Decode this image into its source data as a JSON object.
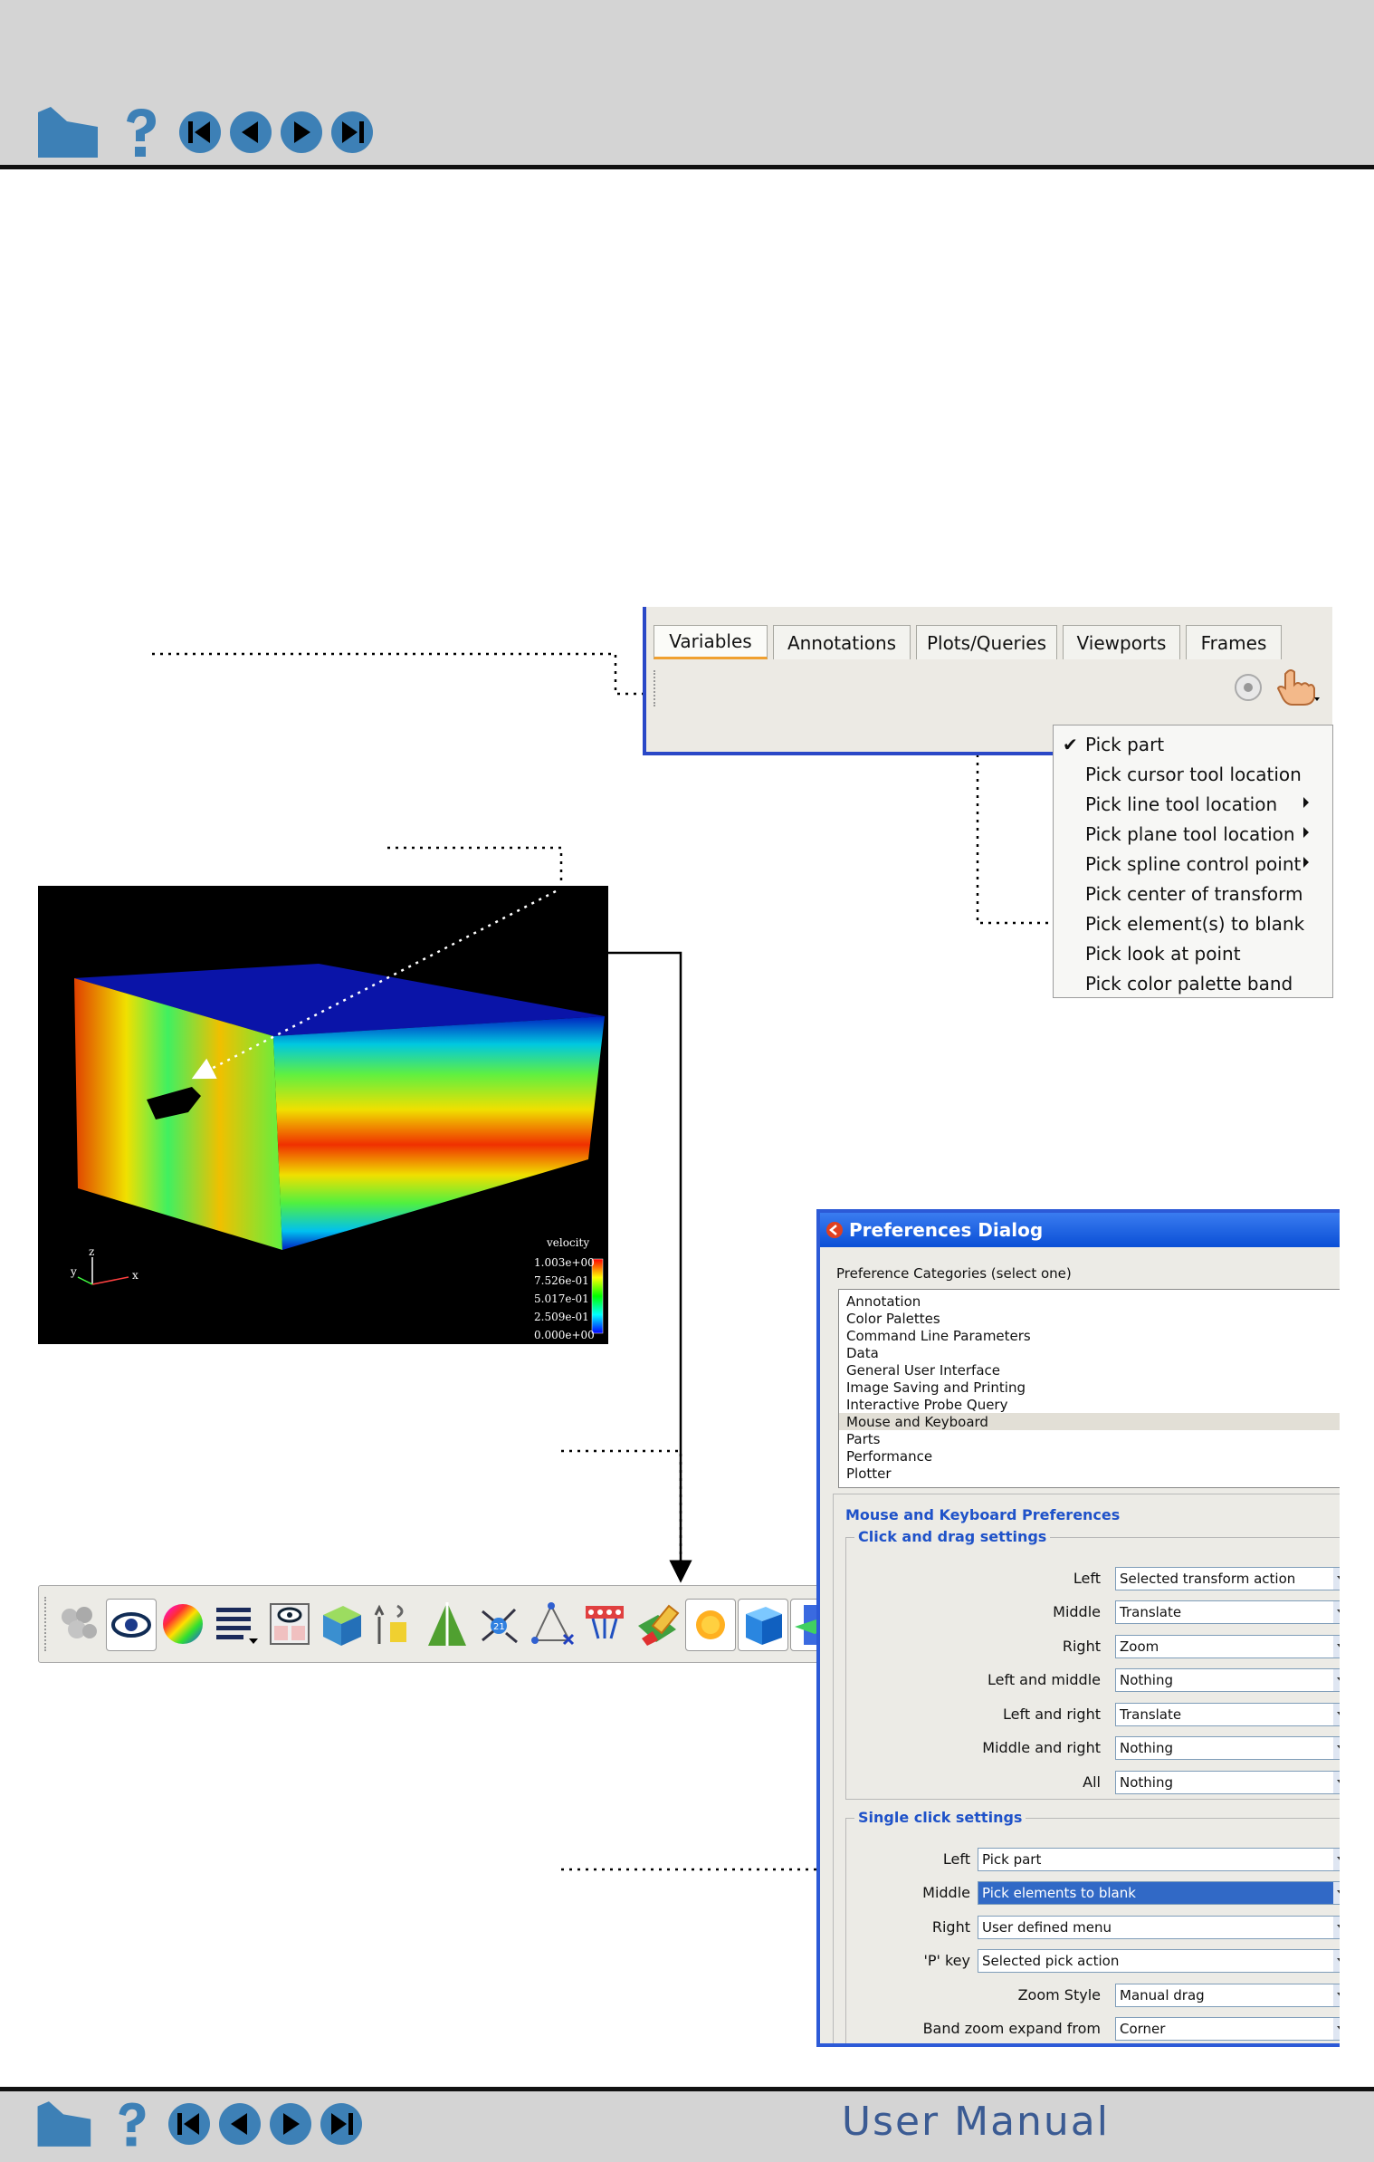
{
  "footer": {
    "title": "User Manual"
  },
  "nav": {
    "buttons": [
      "home-icon",
      "help-icon",
      "first-page-icon",
      "previous-page-icon",
      "next-page-icon",
      "last-page-icon"
    ]
  },
  "tabs": [
    "Variables",
    "Annotations",
    "Plots/Queries",
    "Viewports",
    "Frames"
  ],
  "pick_menu": {
    "items": [
      {
        "label": "Pick part",
        "checked": true,
        "submenu": false
      },
      {
        "label": "Pick cursor tool location",
        "checked": false,
        "submenu": false
      },
      {
        "label": "Pick line tool location",
        "checked": false,
        "submenu": true
      },
      {
        "label": "Pick plane tool location",
        "checked": false,
        "submenu": true
      },
      {
        "label": "Pick spline control point",
        "checked": false,
        "submenu": true
      },
      {
        "label": "Pick center of transform",
        "checked": false,
        "submenu": false
      },
      {
        "label": "Pick element(s) to blank",
        "checked": false,
        "submenu": false
      },
      {
        "label": "Pick look at point",
        "checked": false,
        "submenu": false
      },
      {
        "label": "Pick color palette band",
        "checked": false,
        "submenu": false
      }
    ]
  },
  "viewport": {
    "legend_title": "velocity",
    "legend_values": [
      "1.003e+00",
      "7.526e-01",
      "5.017e-01",
      "2.509e-01",
      "0.000e+00"
    ],
    "axis_labels": {
      "x": "x",
      "y": "y",
      "z": "z"
    }
  },
  "toolbar": {
    "tools": [
      "parts-icon",
      "visibility-eye-icon",
      "color-palette-icon",
      "line-style-icon",
      "view-mode-icon",
      "grid-cube-icon",
      "element-tool-icon",
      "clip-tool-icon",
      "coordinate-tool-icon",
      "node-tool-icon",
      "particle-tool-icon",
      "blank-eraser-icon",
      "light-sun-icon",
      "shaded-cube-icon",
      "plane-tool-icon",
      "lightning-icon"
    ]
  },
  "prefs": {
    "title": "Preferences Dialog",
    "categories_label": "Preference Categories (select one)",
    "categories": [
      "Annotation",
      "Color Palettes",
      "Command Line Parameters",
      "Data",
      "General User Interface",
      "Image Saving and Printing",
      "Interactive Probe Query",
      "Mouse and Keyboard",
      "Parts",
      "Performance",
      "Plotter"
    ],
    "selected_category": "Mouse and Keyboard",
    "section_title": "Mouse and Keyboard Preferences",
    "drag_group": "Click and drag settings",
    "drag_rows": [
      {
        "label": "Left",
        "value": "Selected transform action"
      },
      {
        "label": "Middle",
        "value": "Translate"
      },
      {
        "label": "Right",
        "value": "Zoom"
      },
      {
        "label": "Left and middle",
        "value": "Nothing"
      },
      {
        "label": "Left and right",
        "value": "Translate"
      },
      {
        "label": "Middle and right",
        "value": "Nothing"
      },
      {
        "label": "All",
        "value": "Nothing"
      }
    ],
    "single_group": "Single click settings",
    "single_rows": [
      {
        "label": "Left",
        "value": "Pick part",
        "selected": false
      },
      {
        "label": "Middle",
        "value": "Pick elements to blank",
        "selected": true
      },
      {
        "label": "Right",
        "value": "User defined menu",
        "selected": false
      },
      {
        "label": "'P' key",
        "value": "Selected pick action",
        "selected": false
      },
      {
        "label": "Zoom Style",
        "value": "Manual drag",
        "selected": false
      },
      {
        "label": "Band zoom expand from",
        "value": "Corner",
        "selected": false
      }
    ]
  },
  "colors": {
    "header_bg": "#d4d4d4",
    "nav_blue": "#3d80b6",
    "dialog_title": "#0a4fd6",
    "selection": "#3169c6",
    "group_title": "#1f52c9"
  }
}
